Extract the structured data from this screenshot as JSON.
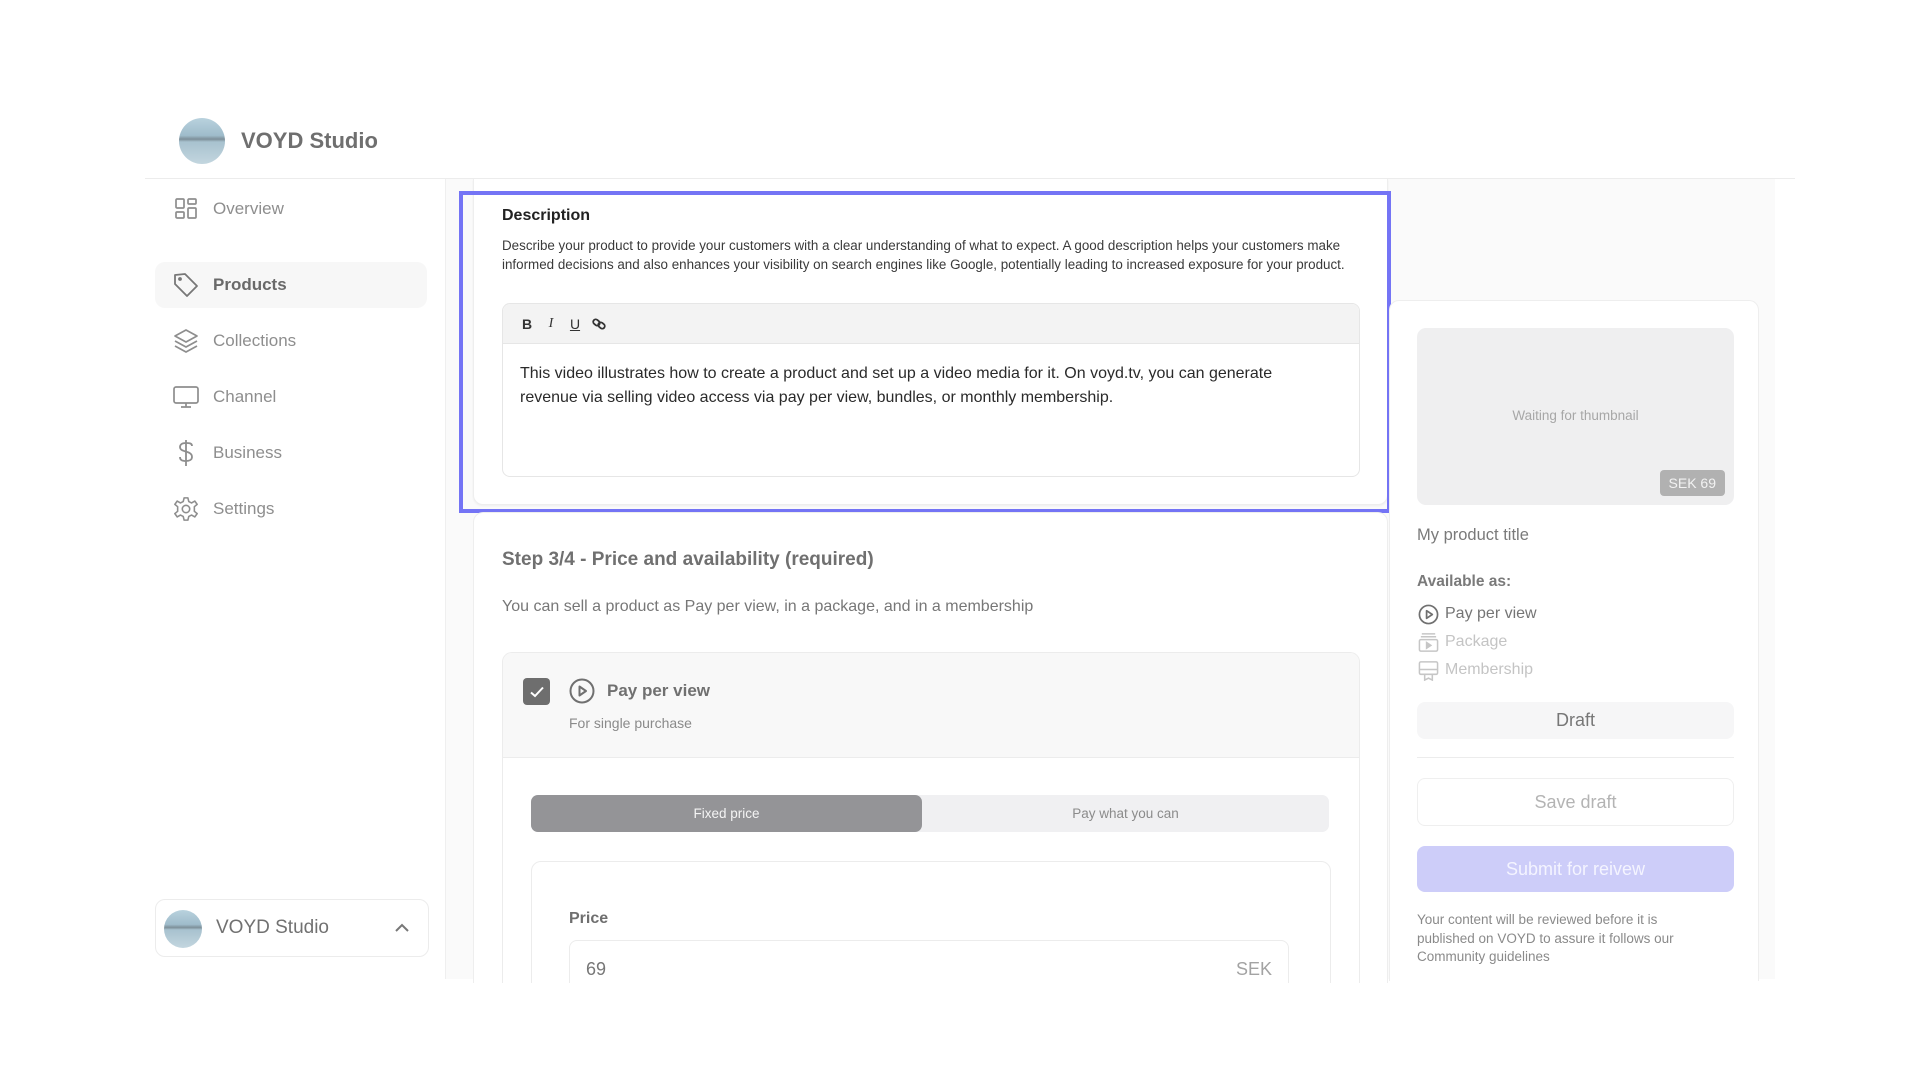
{
  "app": {
    "title": "VOYD Studio"
  },
  "sidebar": {
    "items": [
      {
        "label": "Overview",
        "icon": "dashboard-icon",
        "active": false
      },
      {
        "label": "Products",
        "icon": "tag-icon",
        "active": true
      },
      {
        "label": "Collections",
        "icon": "layers-icon",
        "active": false
      },
      {
        "label": "Channel",
        "icon": "monitor-icon",
        "active": false
      },
      {
        "label": "Business",
        "icon": "dollar-icon",
        "active": false
      },
      {
        "label": "Settings",
        "icon": "gear-icon",
        "active": false
      }
    ],
    "account": {
      "name": "VOYD Studio",
      "icon": "chevron-up-icon"
    }
  },
  "description": {
    "title": "Description",
    "help": "Describe your product to provide your customers with a clear understanding of what to expect. A good description helps your customers make informed decisions and also enhances your visibility on search engines like Google, potentially leading to increased exposure for your product.",
    "toolbar": {
      "bold": "B",
      "italic": "I",
      "underline": "U",
      "link_icon": "link-icon"
    },
    "content": "This video illustrates how to create a product and set up a video media for it. On voyd.tv, you can generate revenue via selling video access via pay per view, bundles, or monthly membership."
  },
  "step": {
    "title": "Step 3/4 - Price and availability (required)",
    "subtitle": "You can sell a product as Pay per view, in a package, and in a membership",
    "pay_per_view": {
      "checked": true,
      "label": "Pay per view",
      "sublabel": "For single purchase",
      "pricing_modes": [
        "Fixed price",
        "Pay what you can"
      ],
      "selected_mode": "Fixed price",
      "price_label": "Price",
      "price_value": "69",
      "currency": "SEK"
    }
  },
  "summary": {
    "thumbnail_text": "Waiting for thumbnail",
    "price_badge": "SEK 69",
    "product_title": "My product title",
    "available_label": "Available as:",
    "availability": [
      {
        "label": "Pay per view",
        "enabled": true
      },
      {
        "label": "Package",
        "enabled": false
      },
      {
        "label": "Membership",
        "enabled": false
      }
    ],
    "status": "Draft",
    "save_label": "Save draft",
    "submit_label": "Submit for reivew",
    "review_note": "Your content will be reviewed before it is published on VOYD to assure it follows our Community guidelines"
  },
  "colors": {
    "highlight": "#7474f5",
    "submit": "#cdcdf9",
    "active_nav_bg": "#f7f7f7"
  }
}
